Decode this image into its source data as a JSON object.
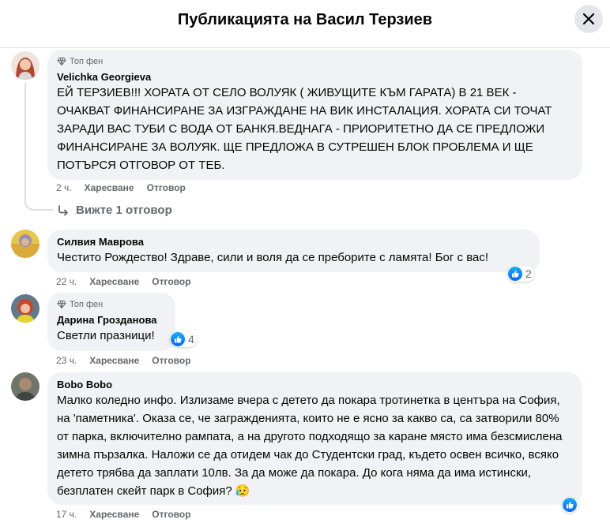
{
  "header": {
    "title": "Публикацията на Васил Терзиев"
  },
  "comments": [
    {
      "badge": "Топ фен",
      "author": "Velichka Georgieva",
      "text": "ЕЙ ТЕРЗИЕВ!!! ХОРАТА ОТ СЕЛО ВОЛУЯК ( ЖИВУЩИТЕ КЪМ ГАРАТА) В 21 ВЕК - ОЧАКВАТ ФИНАНСИРАНЕ ЗА ИЗГРАЖДАНЕ НА ВИК ИНСТАЛАЦИЯ. ХОРАТА СИ ТОЧАТ ЗАРАДИ ВАС ТУБИ С ВОДА ОТ БАНКЯ.ВЕДНАГА - ПРИОРИТЕТНО ДА СЕ ПРЕДЛОЖИ ФИНАНСИРАНЕ ЗА ВОЛУЯК. ЩЕ ПРЕДЛОЖА В СУТРЕШЕН БЛОК ПРОБЛЕМА И ЩЕ ПОТЪРСЯ ОТГОВОР ОТ ТЕБ.",
      "time": "2 ч.",
      "like": "Харесване",
      "reply": "Отговор",
      "view_replies": "Вижте 1 отговор"
    },
    {
      "author": "Силвия Маврова",
      "text": "Честито Рождество! Здраве, сили и воля да се преборите с ламята! Бог с вас!",
      "time": "22 ч.",
      "like": "Харесване",
      "reply": "Отговор",
      "reactions": "2"
    },
    {
      "badge": "Топ фен",
      "author": "Дарина Грозданова",
      "text": "Светли празници!",
      "time": "23 ч.",
      "like": "Харесване",
      "reply": "Отговор",
      "reactions": "4"
    },
    {
      "author": "Bobo Bobo",
      "text": "Малко коледно инфо. Излизаме вчера с детето да покара тротинетка в центъра на София, на 'паметника'. Оказа се, че загражденията, които не е ясно за какво са, са затворили 80% от парка, включително рампата, а на другото подходящо за каране място има безсмислена зимна пързалка. Наложи се да отидем чак до Студентски град, където освен всичко, всяко детето трябва да заплати 10лв. За да може да покара. До кога няма да има истински, безплатен скейт парк в София?",
      "emoji": "😥",
      "time": "17 ч.",
      "like": "Харесване",
      "reply": "Отговор"
    }
  ],
  "colors": {
    "like_blue": "#0866ff",
    "bubble": "#f0f2f5",
    "meta": "#65676b"
  }
}
